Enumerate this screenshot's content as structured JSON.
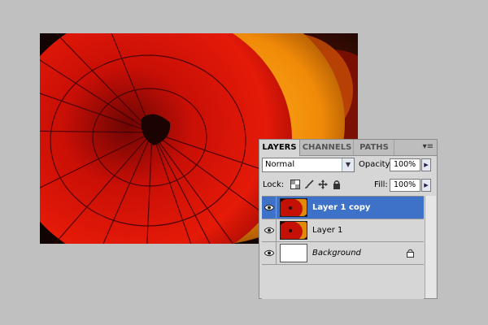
{
  "panel": {
    "tabs": [
      {
        "label": "LAYERS",
        "active": true
      },
      {
        "label": "CHANNELS",
        "active": false
      },
      {
        "label": "PATHS",
        "active": false
      }
    ],
    "menu_icon": "panel-menu-icon",
    "blend_mode": "Normal",
    "opacity_label": "Opacity:",
    "opacity_value": "100%",
    "lock_label": "Lock:",
    "fill_label": "Fill:",
    "fill_value": "100%",
    "lock_icons": [
      "lock-transparent-icon",
      "lock-image-icon",
      "lock-position-icon",
      "lock-all-icon"
    ],
    "layers": [
      {
        "name": "Layer 1 copy",
        "selected": true,
        "thumbnail": "umbrella",
        "visible": true
      },
      {
        "name": "Layer 1",
        "selected": false,
        "thumbnail": "umbrella",
        "visible": true
      },
      {
        "name": "Background",
        "selected": false,
        "thumbnail": "white",
        "visible": true,
        "locked": true
      }
    ]
  },
  "colors": {
    "selection": "#3d72c8",
    "panel_bg": "#d6d6d6",
    "workspace_bg": "#c0c0c0"
  }
}
